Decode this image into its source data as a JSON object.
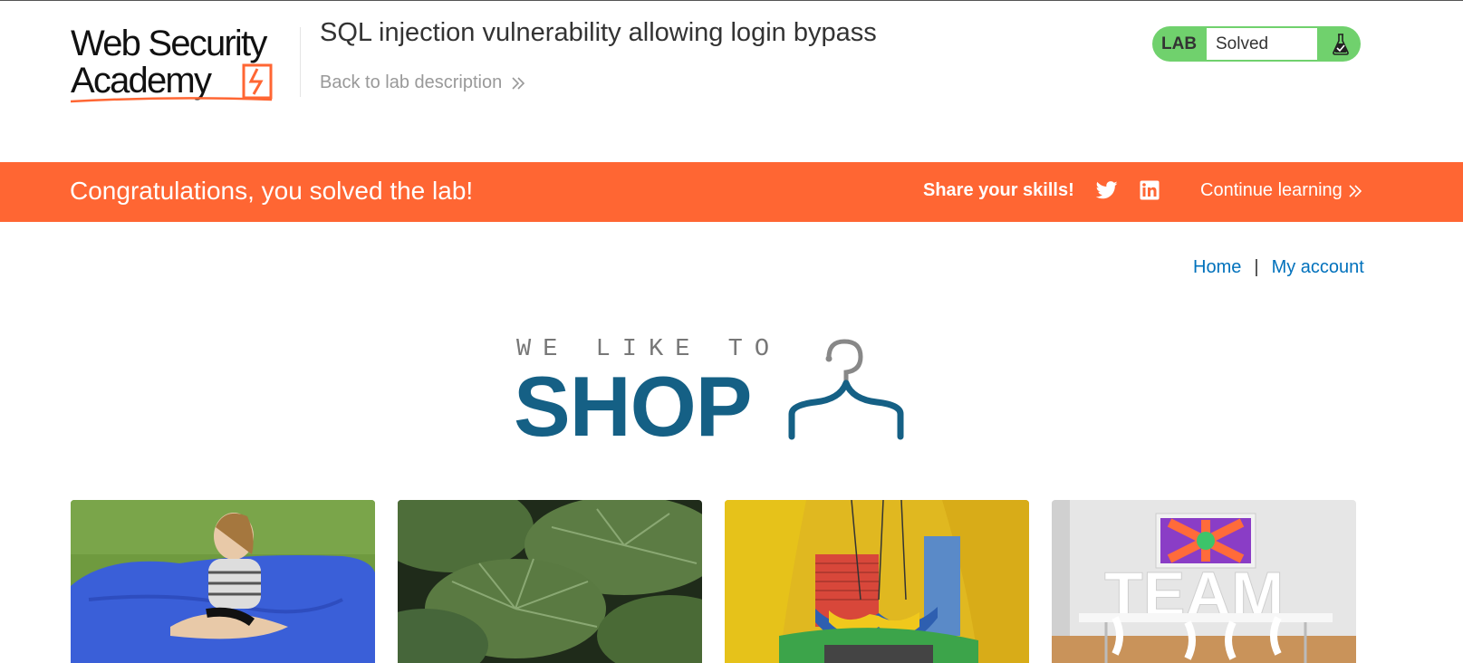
{
  "header": {
    "logo_line1": "Web Security",
    "logo_line2": "Academy",
    "lab_title": "SQL injection vulnerability allowing login bypass",
    "back_link": "Back to lab description",
    "status": {
      "tag": "LAB",
      "value": "Solved",
      "color": "#70d16d"
    }
  },
  "banner": {
    "color": "#ff6633",
    "message": "Congratulations, you solved the lab!",
    "share_label": "Share your skills!",
    "social_icons": [
      "twitter-icon",
      "linkedin-icon"
    ],
    "continue_label": "Continue learning"
  },
  "nav": {
    "home": "Home",
    "separator": "|",
    "account": "My account",
    "link_color": "#0071bc"
  },
  "shop_logo": {
    "tagline": "WE LIKE TO",
    "word": "SHOP",
    "brand_color": "#156085",
    "icon": "hanger-icon"
  },
  "products": [
    {
      "image": "girl-on-blue-beanbag"
    },
    {
      "image": "green-leaves"
    },
    {
      "image": "inflatable-playhouse"
    },
    {
      "image": "team-sign-meeting-room"
    }
  ]
}
